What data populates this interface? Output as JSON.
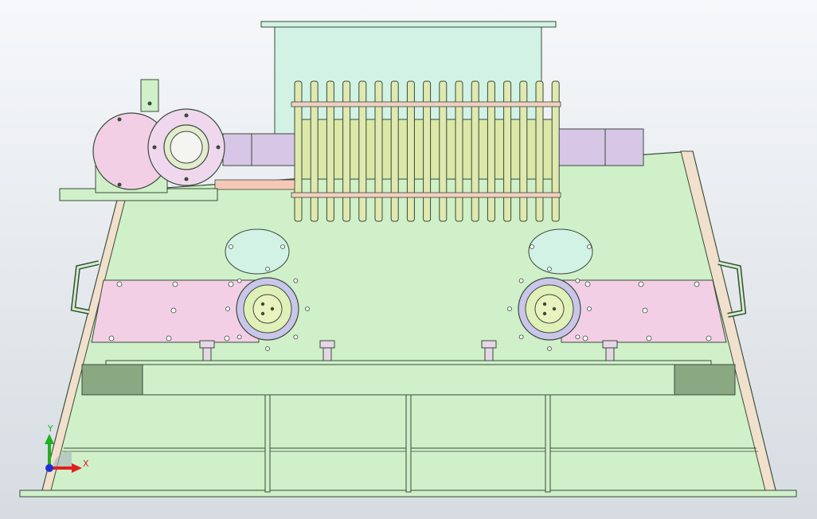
{
  "viewport": {
    "axis_x_label": "X",
    "axis_y_label": "Y"
  },
  "colors": {
    "background_top": "#f6f8fa",
    "background_bottom": "#d6dce2",
    "frame_fill": "#cff0c8",
    "frame_stroke": "#3a4a3a",
    "hopper_fill": "#d2f2e6",
    "pink_fill": "#f3cfe6",
    "pink_shaft": "#d8c6e6",
    "dark_green_block": "#8aa882",
    "bearing_fill": "#dff0b8",
    "ring_fill": "#c9c6ea",
    "axis_x_color": "#e02020",
    "axis_y_color": "#20b020",
    "axis_origin_color": "#2030d0"
  },
  "icons": [
    "axis-triad-icon"
  ]
}
